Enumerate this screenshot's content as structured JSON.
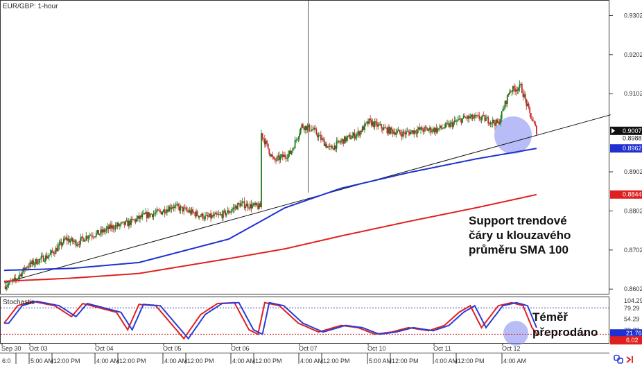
{
  "chart_data": {
    "type": "candlestick",
    "symbol_label": "EUR/GBP: 1-hour",
    "stochastic_label": "Stochastic",
    "ylim": [
      0.859,
      0.934
    ],
    "y_ticks": [
      "0.9302",
      "0.9202",
      "0.9102",
      "0.8902",
      "0.8802",
      "0.8702",
      "0.8602"
    ],
    "price_tags": [
      {
        "label": "0.9007",
        "value": 0.9007,
        "style": "current"
      },
      {
        "label": "0.8988",
        "value": 0.8988,
        "style": "plain"
      },
      {
        "label": "0.8962",
        "value": 0.8962,
        "style": "sma100"
      },
      {
        "label": "0.8844",
        "value": 0.8844,
        "style": "sma200"
      }
    ],
    "date_labels": [
      "Sep 30",
      "Oct 03",
      "Oct 04",
      "Oct 05",
      "Oct 06",
      "Oct 07",
      "Oct 10",
      "Oct 11",
      "Oct 12"
    ],
    "time_labels": [
      "6:0",
      "5:00 AM",
      "12:00 PM",
      "4:00 AM",
      "12:00 PM",
      "4:00 AM",
      "12:00 PM",
      "4:00 AM",
      "12:00 PM",
      "4:00 AM",
      "12:00 PM",
      "5:00 AM",
      "12:00 PM",
      "4:00 AM",
      "12:00 PM",
      "4:00 AM"
    ],
    "price_anchors": [
      [
        0,
        0.861
      ],
      [
        10,
        0.8625
      ],
      [
        20,
        0.866
      ],
      [
        30,
        0.8675
      ],
      [
        38,
        0.8685
      ],
      [
        45,
        0.87
      ],
      [
        55,
        0.873
      ],
      [
        65,
        0.872
      ],
      [
        75,
        0.874
      ],
      [
        85,
        0.8745
      ],
      [
        95,
        0.876
      ],
      [
        110,
        0.877
      ],
      [
        125,
        0.879
      ],
      [
        140,
        0.88
      ],
      [
        150,
        0.8815
      ],
      [
        165,
        0.88
      ],
      [
        180,
        0.8785
      ],
      [
        192,
        0.879
      ],
      [
        200,
        0.88
      ],
      [
        210,
        0.882
      ],
      [
        220,
        0.8815
      ],
      [
        228,
        0.8812
      ],
      [
        229,
        0.9
      ],
      [
        240,
        0.893
      ],
      [
        255,
        0.895
      ],
      [
        265,
        0.902
      ],
      [
        275,
        0.901
      ],
      [
        290,
        0.896
      ],
      [
        300,
        0.898
      ],
      [
        315,
        0.9
      ],
      [
        325,
        0.903
      ],
      [
        340,
        0.901
      ],
      [
        355,
        0.9
      ],
      [
        370,
        0.901
      ],
      [
        385,
        0.901
      ],
      [
        395,
        0.902
      ],
      [
        410,
        0.904
      ],
      [
        425,
        0.904
      ],
      [
        440,
        0.9025
      ],
      [
        450,
        0.911
      ],
      [
        460,
        0.912
      ],
      [
        468,
        0.905
      ],
      [
        474,
        0.9007
      ]
    ],
    "sma100": [
      [
        0,
        0.865
      ],
      [
        60,
        0.8655
      ],
      [
        120,
        0.867
      ],
      [
        200,
        0.873
      ],
      [
        250,
        0.881
      ],
      [
        300,
        0.886
      ],
      [
        360,
        0.89
      ],
      [
        420,
        0.8935
      ],
      [
        460,
        0.8955
      ],
      [
        474,
        0.8962
      ]
    ],
    "sma200": [
      [
        0,
        0.8622
      ],
      [
        60,
        0.863
      ],
      [
        120,
        0.8642
      ],
      [
        200,
        0.868
      ],
      [
        250,
        0.8705
      ],
      [
        300,
        0.8738
      ],
      [
        360,
        0.8775
      ],
      [
        420,
        0.881
      ],
      [
        460,
        0.8835
      ],
      [
        474,
        0.8844
      ]
    ],
    "trendline": [
      [
        0,
        0.8618
      ],
      [
        540,
        0.9048
      ]
    ],
    "stochastic": {
      "ylim": [
        0,
        104.29
      ],
      "y_ticks": [
        "104.29",
        "79.29",
        "54.29",
        "29.29"
      ],
      "levels": [
        80,
        20
      ],
      "tags": [
        {
          "label": "21.76",
          "value": 21.76
        },
        {
          "label": "6.02",
          "value": 6.02
        }
      ],
      "k_anchors": [
        [
          0,
          45
        ],
        [
          12,
          85
        ],
        [
          25,
          95
        ],
        [
          45,
          85
        ],
        [
          60,
          60
        ],
        [
          70,
          90
        ],
        [
          85,
          80
        ],
        [
          100,
          70
        ],
        [
          110,
          30
        ],
        [
          120,
          88
        ],
        [
          135,
          85
        ],
        [
          160,
          10
        ],
        [
          175,
          65
        ],
        [
          190,
          90
        ],
        [
          205,
          92
        ],
        [
          218,
          30
        ],
        [
          226,
          20
        ],
        [
          232,
          92
        ],
        [
          245,
          85
        ],
        [
          262,
          45
        ],
        [
          280,
          25
        ],
        [
          300,
          40
        ],
        [
          315,
          35
        ],
        [
          330,
          20
        ],
        [
          345,
          25
        ],
        [
          360,
          35
        ],
        [
          378,
          28
        ],
        [
          392,
          40
        ],
        [
          405,
          70
        ],
        [
          415,
          85
        ],
        [
          425,
          35
        ],
        [
          440,
          85
        ],
        [
          452,
          92
        ],
        [
          462,
          85
        ],
        [
          470,
          35
        ],
        [
          474,
          21
        ]
      ]
    },
    "annotations": {
      "support_text": [
        "Support trendové",
        "čáry u klouzavého",
        "průměru SMA 100"
      ],
      "oversold_text": [
        "Téměř",
        "přeprodáno"
      ]
    },
    "colors": {
      "bull": "#1b7a1b",
      "bear": "#c62828",
      "sma100": "#1f2fd0",
      "sma200": "#e02020",
      "trendline": "#111111",
      "highlight": "#7f86f0",
      "stoch_k": "#e02020",
      "stoch_d": "#2a3cd8"
    }
  }
}
